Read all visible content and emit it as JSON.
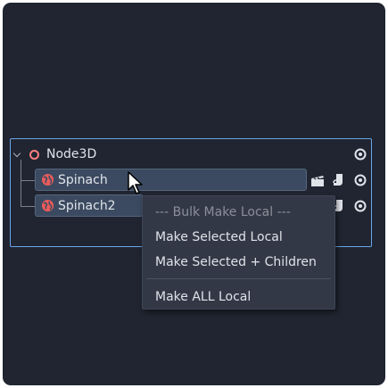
{
  "tree": {
    "root": {
      "label": "Node3D",
      "icon": "node3d-icon"
    },
    "children": [
      {
        "label": "Spinach",
        "icon": "globe-icon",
        "selected": true
      },
      {
        "label": "Spinach2",
        "icon": "globe-icon",
        "selected": true
      }
    ]
  },
  "context_menu": {
    "header": "--- Bulk Make Local ---",
    "items": [
      {
        "label": "Make Selected Local"
      },
      {
        "label": "Make Selected + Children"
      },
      {
        "label": "Make ALL Local"
      }
    ]
  },
  "colors": {
    "panel_bg": "#202531",
    "accent_border": "#6aa6e8",
    "selection_bg": "#3b4a60",
    "node_icon": "#fc7f7f",
    "globe_icon": "#e85c5c",
    "menu_bg": "#323846"
  }
}
